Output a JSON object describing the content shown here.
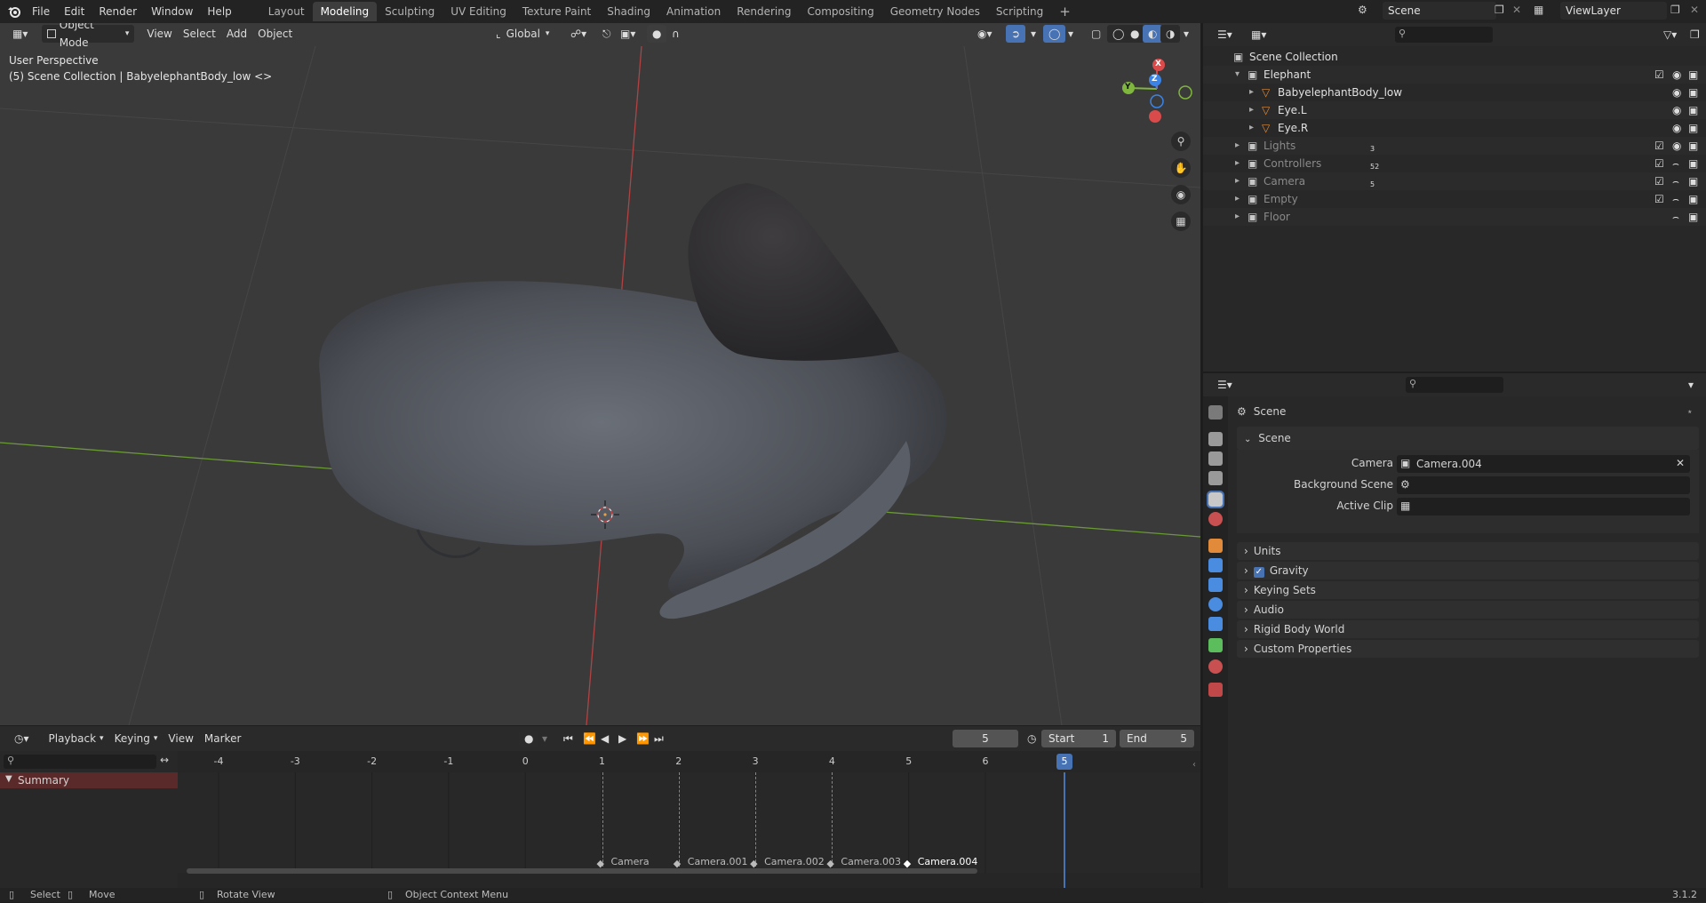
{
  "topbar": {
    "menus": [
      "File",
      "Edit",
      "Render",
      "Window",
      "Help"
    ],
    "workspaces": [
      "Layout",
      "Modeling",
      "Sculpting",
      "UV Editing",
      "Texture Paint",
      "Shading",
      "Animation",
      "Rendering",
      "Compositing",
      "Geometry Nodes",
      "Scripting"
    ],
    "active_workspace": "Modeling",
    "add_tab": "+",
    "scene_name": "Scene",
    "view_layer": "ViewLayer"
  },
  "viewport": {
    "mode": "Object Mode",
    "menus": [
      "View",
      "Select",
      "Add",
      "Object"
    ],
    "transform_orientation": "Global",
    "perspective_label": "User Perspective",
    "collection_label": "(5) Scene Collection | BabyelephantBody_low <>",
    "gizmo_axes": {
      "x": "X",
      "y": "Y",
      "z": "Z"
    }
  },
  "timeline": {
    "menus": [
      "Playback",
      "Keying",
      "View",
      "Marker"
    ],
    "current_frame": "5",
    "start_label": "Start",
    "start_value": "1",
    "end_label": "End",
    "end_value": "5",
    "ruler_ticks": [
      "-4",
      "-3",
      "-2",
      "-1",
      "0",
      "1",
      "2",
      "3",
      "4",
      "5",
      "6"
    ],
    "summary_label": "Summary",
    "markers": [
      "Camera",
      "Camera.001",
      "Camera.002",
      "Camera.003",
      "Camera.004"
    ]
  },
  "outliner": {
    "root": "Scene Collection",
    "items": [
      {
        "name": "Elephant",
        "badge": ""
      },
      {
        "name": "BabyelephantBody_low",
        "badge": ""
      },
      {
        "name": "Eye.L",
        "badge": ""
      },
      {
        "name": "Eye.R",
        "badge": ""
      },
      {
        "name": "Lights",
        "badge": "3"
      },
      {
        "name": "Controllers",
        "badge": "52"
      },
      {
        "name": "Camera",
        "badge": "5"
      },
      {
        "name": "Empty",
        "badge": ""
      },
      {
        "name": "Floor",
        "badge": ""
      }
    ]
  },
  "properties": {
    "breadcrumb": "Scene",
    "section_title": "Scene",
    "fields": [
      {
        "label": "Camera",
        "value": "Camera.004"
      },
      {
        "label": "Background Scene",
        "value": ""
      },
      {
        "label": "Active Clip",
        "value": ""
      }
    ],
    "panels": [
      "Units",
      "Gravity",
      "Keying Sets",
      "Audio",
      "Rigid Body World",
      "Custom Properties"
    ]
  },
  "statusbar": {
    "items": [
      "Select",
      "Move",
      "Rotate View",
      "Object Context Menu"
    ],
    "version": "3.1.2"
  },
  "colors": {
    "accent_blue": "#4772b3",
    "axis_x": "#e04a4a",
    "axis_y": "#7fb63d",
    "axis_z": "#3b84e6",
    "summary_bg": "#5a2a2a"
  }
}
